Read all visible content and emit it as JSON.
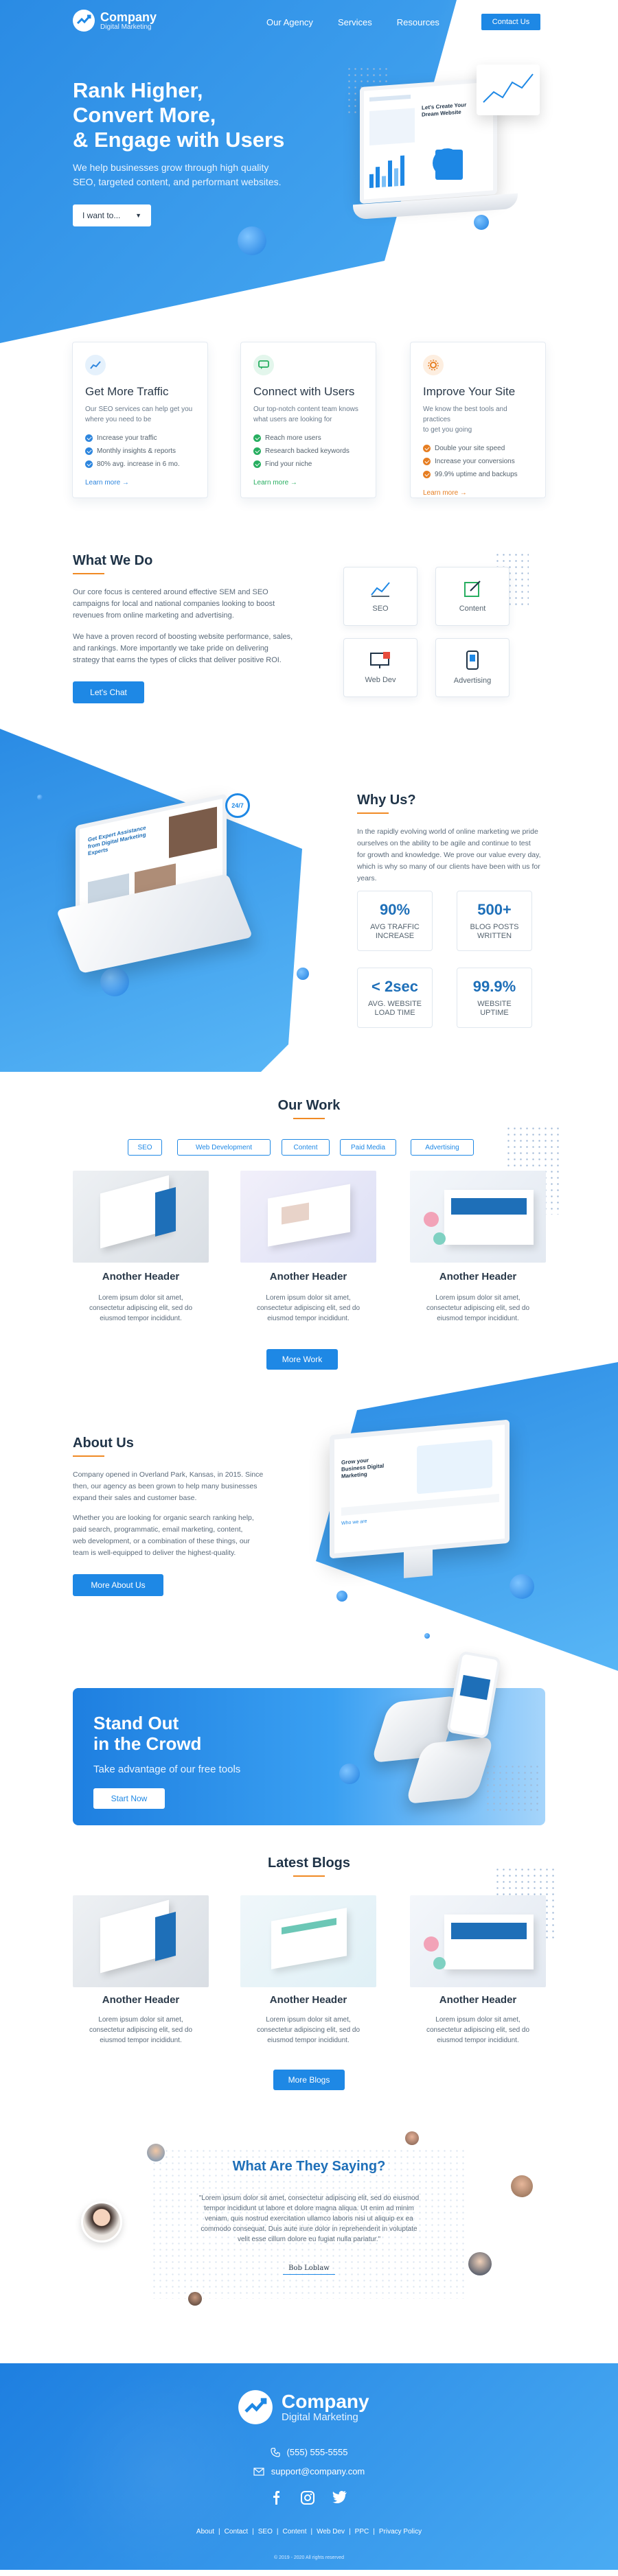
{
  "header": {
    "brand": "Company",
    "tagline": "Digital Marketing",
    "nav": [
      "Our Agency",
      "Services",
      "Resources"
    ],
    "cta": "Contact Us"
  },
  "hero": {
    "title_lines": [
      "Rank Higher,",
      "Convert More,",
      "& Engage with Users"
    ],
    "subtitle_lines": [
      "We help businesses grow through high quality",
      "SEO, targeted content, and performant websites."
    ],
    "dropdown": "I want to...",
    "mock": {
      "heading_lines": [
        "Let's Create Your",
        "Dream Website"
      ]
    }
  },
  "features": [
    {
      "title": "Get More Traffic",
      "text_lines": [
        "Our SEO services can help get you",
        "where you need to be"
      ],
      "items": [
        "Increase your traffic",
        "Monthly insights & reports",
        "80% avg. increase in 6 mo."
      ],
      "link": "Learn more →",
      "color": "#2e86de",
      "icon": "chart-icon"
    },
    {
      "title": "Connect with Users",
      "text_lines": [
        "Our top-notch content team knows",
        "what users are looking for"
      ],
      "items": [
        "Reach more users",
        "Research backed keywords",
        "Find your niche"
      ],
      "link": "Learn more →",
      "color": "#27ae60",
      "icon": "chat-icon"
    },
    {
      "title": "Improve Your Site",
      "text_lines": [
        "We know the best tools and practices",
        "to get you going"
      ],
      "items": [
        "Double your site speed",
        "Increase your conversions",
        "99.9% uptime and backups"
      ],
      "link": "Learn more →",
      "color": "#e67e22",
      "icon": "gear-icon"
    }
  ],
  "what_we_do": {
    "title": "What We Do",
    "para1_lines": [
      "Our core focus is centered around effective SEM and SEO",
      "campaigns for local and national companies looking to boost",
      "revenues from online marketing and advertising."
    ],
    "para2_lines": [
      "We have a proven record of boosting website performance, sales,",
      "and rankings. More importantly we take pride on delivering",
      "strategy that earns the types of clicks that deliver positive ROI."
    ],
    "button": "Let's Chat",
    "services": [
      "SEO",
      "Content",
      "Web Dev",
      "Advertising"
    ]
  },
  "why_us": {
    "title": "Why Us?",
    "text_lines": [
      "In the rapidly evolving world of online marketing we pride",
      "ourselves on the ability to be agile and continue to test",
      "for growth and knowledge. We prove our value every day,",
      "which is why so many of our clients have been with us for",
      "years."
    ],
    "stats": [
      {
        "value": "90%",
        "label_lines": [
          "AVG TRAFFIC",
          "INCREASE"
        ]
      },
      {
        "value": "500+",
        "label_lines": [
          "BLOG POSTS",
          "WRITTEN"
        ]
      },
      {
        "value": "< 2sec",
        "label_lines": [
          "AVG. WEBSITE",
          "LOAD TIME"
        ]
      },
      {
        "value": "99.9%",
        "label_lines": [
          "WEBSITE",
          "UPTIME"
        ]
      }
    ],
    "mock": {
      "heading_lines": [
        "Get Expert Assistance",
        "from Digital Marketing",
        "Experts"
      ],
      "badge": "24/7"
    }
  },
  "our_work": {
    "title": "Our Work",
    "tabs": [
      "SEO",
      "Web Development",
      "Content",
      "Paid Media",
      "Advertising"
    ],
    "items": [
      {
        "title": "Another Header",
        "text_lines": [
          "Lorem ipsum dolor sit amet,",
          "consectetur adipiscing elit, sed do",
          "eiusmod tempor incididunt."
        ]
      },
      {
        "title": "Another Header",
        "text_lines": [
          "Lorem ipsum dolor sit amet,",
          "consectetur adipiscing elit, sed do",
          "eiusmod tempor incididunt."
        ]
      },
      {
        "title": "Another Header",
        "text_lines": [
          "Lorem ipsum dolor sit amet,",
          "consectetur adipiscing elit, sed do",
          "eiusmod tempor incididunt."
        ]
      }
    ],
    "button": "More Work"
  },
  "about": {
    "title": "About Us",
    "para1_lines": [
      "Company opened in Overland Park, Kansas, in 2015. Since",
      "then, our agency as been grown to help many businesses",
      "expand their sales and customer base."
    ],
    "para2_lines": [
      "Whether you are looking for organic search ranking help,",
      "paid search, programmatic, email marketing,  content,",
      "web development, or a combination of these things, our",
      "team is well-equipped to deliver the highest-quality."
    ],
    "button": "More About Us",
    "mock": {
      "heading_lines": [
        "Grow your",
        "Business Digital",
        "Marketing"
      ],
      "tag": "Who we are"
    }
  },
  "cta": {
    "title_lines": [
      "Stand Out",
      "in the Crowd"
    ],
    "subtitle": "Take advantage of our free tools",
    "button": "Start Now"
  },
  "blogs": {
    "title": "Latest Blogs",
    "items": [
      {
        "title": "Another Header",
        "text_lines": [
          "Lorem ipsum dolor sit amet,",
          "consectetur adipiscing elit, sed do",
          "eiusmod tempor incididunt."
        ]
      },
      {
        "title": "Another Header",
        "text_lines": [
          "Lorem ipsum dolor sit amet,",
          "consectetur adipiscing elit, sed do",
          "eiusmod tempor incididunt."
        ]
      },
      {
        "title": "Another Header",
        "text_lines": [
          "Lorem ipsum dolor sit amet,",
          "consectetur adipiscing elit, sed do",
          "eiusmod tempor incididunt."
        ]
      }
    ],
    "button": "More Blogs"
  },
  "testimonials": {
    "title": "What Are They Saying?",
    "quote_lines": [
      "\"Lorem ipsum dolor sit amet, consectetur adipiscing elit, sed do eiusmod",
      "tempor incididunt ut labore et dolore magna aliqua. Ut enim ad minim",
      "veniam, quis nostrud exercitation ullamco laboris nisi ut aliquip ex ea",
      "commodo consequat. Duis aute irure dolor in reprehenderit in voluptate",
      "velit esse cillum dolore eu fugiat nulla pariatur.\""
    ],
    "author": "Bob Loblaw"
  },
  "footer": {
    "brand": "Company",
    "tagline": "Digital Marketing",
    "phone": "(555) 555-5555",
    "email": "support@company.com",
    "links": [
      "About",
      "Contact",
      "SEO",
      "Content",
      "Web Dev",
      "PPC",
      "Privacy Policy"
    ],
    "copyright": "© 2019 - 2020 All rights reserved"
  },
  "colors": {
    "primary": "#1e88e5",
    "accent": "#f08a24",
    "dark": "#1f3347"
  }
}
